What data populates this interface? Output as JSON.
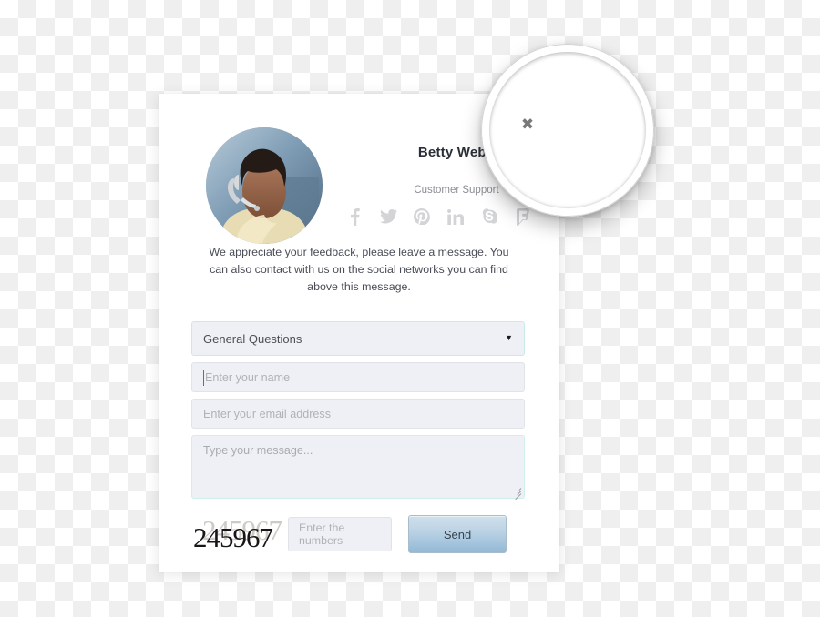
{
  "card": {
    "agent": {
      "name": "Betty Webb",
      "role": "Customer Support",
      "avatar_icon": "support-agent-photo"
    },
    "social": [
      {
        "name": "facebook",
        "glyph": "facebook-icon"
      },
      {
        "name": "twitter",
        "glyph": "twitter-icon"
      },
      {
        "name": "pinterest",
        "glyph": "pinterest-icon"
      },
      {
        "name": "linkedin",
        "glyph": "linkedin-icon"
      },
      {
        "name": "skype",
        "glyph": "skype-icon"
      },
      {
        "name": "foursquare",
        "glyph": "foursquare-icon"
      }
    ],
    "intro": "We appreciate your feedback, please leave a message. You can also contact with us on the social networks you can find above this message.",
    "form": {
      "subject": {
        "selected": "General Questions",
        "caret": "▼"
      },
      "name_field": {
        "value": "",
        "placeholder": "Enter your name"
      },
      "email_field": {
        "value": "",
        "placeholder": "Enter your email address"
      },
      "message_field": {
        "value": "",
        "placeholder": "Type your message..."
      },
      "captcha": {
        "code": "245967",
        "input_placeholder": "Enter the numbers"
      },
      "send_label": "Send"
    }
  },
  "overlay": {
    "close_icon": "✖"
  },
  "colors": {
    "send_button_top": "#cfdfec",
    "send_button_bottom": "#93b9d4",
    "field_background": "#eff0f5",
    "select_border": "#c9eae8",
    "placeholder_text": "#b0b2b8",
    "checker_gray": "#efefef"
  }
}
